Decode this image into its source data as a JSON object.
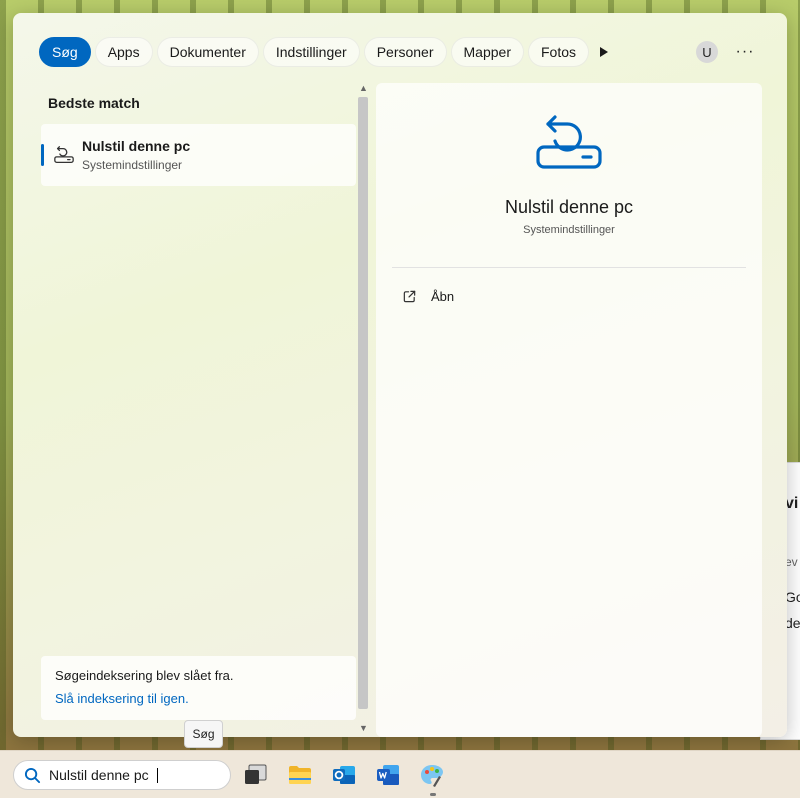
{
  "search_panel": {
    "filters": [
      {
        "label": "Søg",
        "active": true
      },
      {
        "label": "Apps",
        "active": false
      },
      {
        "label": "Dokumenter",
        "active": false
      },
      {
        "label": "Indstillinger",
        "active": false
      },
      {
        "label": "Personer",
        "active": false
      },
      {
        "label": "Mapper",
        "active": false
      },
      {
        "label": "Fotos",
        "active": false
      }
    ],
    "avatar_initial": "U",
    "more_label": "···",
    "best_match_heading": "Bedste match",
    "best_match": {
      "title": "Nulstil denne pc",
      "subtitle": "Systemindstillinger",
      "icon": "reset-pc-icon"
    },
    "indexing_notice": {
      "message": "Søgeindeksering blev slået fra.",
      "link": "Slå indeksering til igen."
    },
    "detail": {
      "title": "Nulstil denne pc",
      "subtitle": "Systemindstillinger",
      "actions": [
        {
          "label": "Åbn",
          "icon": "open-external-icon"
        }
      ]
    }
  },
  "tooltip": "Søg",
  "background_card": {
    "lines": [
      "vi",
      "ev",
      "Go",
      "de"
    ]
  },
  "taskbar": {
    "search_query": "Nulstil denne pc",
    "apps": [
      {
        "name": "task-view",
        "icon": "task-view-icon"
      },
      {
        "name": "file-explorer",
        "icon": "folder-icon"
      },
      {
        "name": "outlook",
        "icon": "outlook-icon"
      },
      {
        "name": "word",
        "icon": "word-icon"
      },
      {
        "name": "paint",
        "icon": "paint-icon"
      }
    ]
  },
  "colors": {
    "accent": "#0067c0"
  }
}
